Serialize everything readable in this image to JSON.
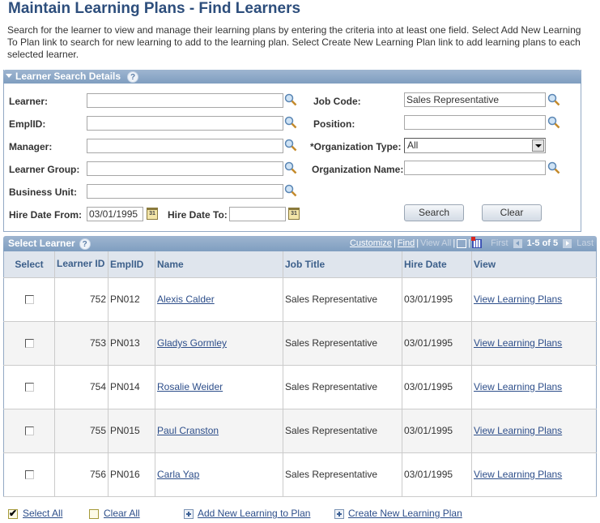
{
  "page": {
    "title": "Maintain Learning Plans - Find Learners",
    "instructions": "Search for the learner to view and manage their learning plans by entering the criteria into at least one field.  Select Add New Learning To Plan link to search for new learning to add to the learning plan.  Select Create New Learning Plan link to add learning plans to each selected learner."
  },
  "search": {
    "header": "Learner Search Details",
    "help_icon": "help-icon",
    "fields": {
      "learner": {
        "label": "Learner:",
        "value": ""
      },
      "emplid": {
        "label": "EmplID:",
        "value": ""
      },
      "manager": {
        "label": "Manager:",
        "value": ""
      },
      "learner_group": {
        "label": "Learner Group:",
        "value": ""
      },
      "business_unit": {
        "label": "Business Unit:",
        "value": ""
      },
      "hire_date_from": {
        "label": "Hire Date From:",
        "value": "03/01/1995"
      },
      "hire_date_to": {
        "label": "Hire Date To:",
        "value": ""
      },
      "job_code": {
        "label": "Job Code:",
        "value": "Sales Representative"
      },
      "position": {
        "label": "Position:",
        "value": ""
      },
      "organization_type": {
        "label": "*Organization Type:",
        "value": "All"
      },
      "organization_name": {
        "label": "Organization Name:",
        "value": ""
      }
    },
    "calendar_icon_text": "31",
    "buttons": {
      "search": "Search",
      "clear": "Clear"
    }
  },
  "grid": {
    "header": "Select Learner",
    "nav": {
      "customize": "Customize",
      "find": "Find",
      "view_all": "View All",
      "first": "First",
      "count": "1-5 of 5",
      "last": "Last"
    },
    "columns": [
      "Select",
      "Learner ID",
      "EmplID",
      "Name",
      "Job Title",
      "Hire Date",
      "View"
    ],
    "rows": [
      {
        "selected": false,
        "learner_id": "752",
        "emplid": "PN012",
        "name": "Alexis Calder",
        "job_title": "Sales Representative",
        "hire_date": "03/01/1995",
        "view": "View Learning Plans"
      },
      {
        "selected": false,
        "learner_id": "753",
        "emplid": "PN013",
        "name": "Gladys Gormley",
        "job_title": "Sales Representative",
        "hire_date": "03/01/1995",
        "view": "View Learning Plans"
      },
      {
        "selected": false,
        "learner_id": "754",
        "emplid": "PN014",
        "name": "Rosalie Weider",
        "job_title": "Sales Representative",
        "hire_date": "03/01/1995",
        "view": "View Learning Plans"
      },
      {
        "selected": false,
        "learner_id": "755",
        "emplid": "PN015",
        "name": "Paul Cranston",
        "job_title": "Sales Representative",
        "hire_date": "03/01/1995",
        "view": "View Learning Plans"
      },
      {
        "selected": false,
        "learner_id": "756",
        "emplid": "PN016",
        "name": "Carla Yap",
        "job_title": "Sales Representative",
        "hire_date": "03/01/1995",
        "view": "View Learning Plans"
      }
    ]
  },
  "actions": {
    "select_all": "Select All",
    "clear_all": "Clear All",
    "add_new_learning": "Add New Learning to Plan",
    "create_new_plan": "Create New Learning Plan"
  },
  "colors": {
    "title": "#2d4e7c",
    "header_bar": "#8aa6c6",
    "link": "#2d4e8a",
    "column_header_bg": "#dfe5ed"
  }
}
